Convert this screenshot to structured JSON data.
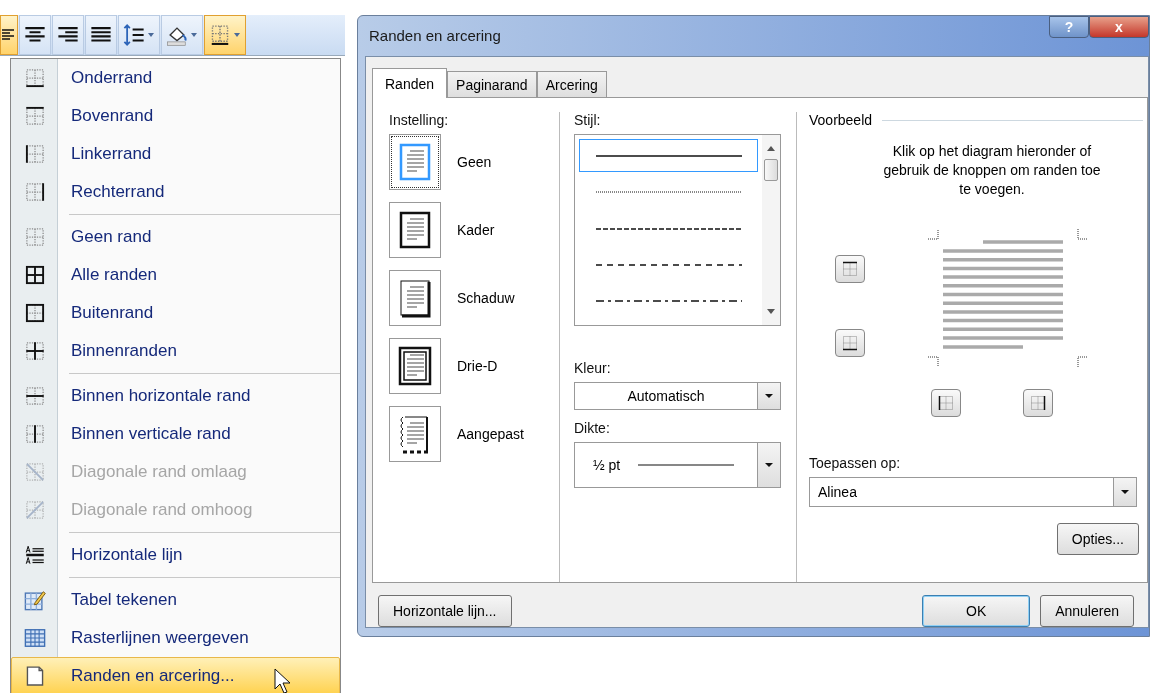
{
  "toolbar": [
    {
      "kind": "align-left",
      "selected": true
    },
    {
      "kind": "align-center",
      "selected": false
    },
    {
      "kind": "align-right",
      "selected": false
    },
    {
      "kind": "justify",
      "selected": false
    },
    {
      "kind": "line-spacing",
      "selected": false
    },
    {
      "kind": "shading",
      "selected": false
    },
    {
      "kind": "borders",
      "selected": true
    }
  ],
  "menu": {
    "items": [
      {
        "label": "Onderrand",
        "kind": "bottom",
        "disabled": false,
        "selected": false,
        "separator_after": false
      },
      {
        "label": "Bovenrand",
        "kind": "top",
        "disabled": false,
        "selected": false,
        "separator_after": false
      },
      {
        "label": "Linkerrand",
        "kind": "left",
        "disabled": false,
        "selected": false,
        "separator_after": false
      },
      {
        "label": "Rechterrand",
        "kind": "right",
        "disabled": false,
        "selected": false,
        "separator_after": true
      },
      {
        "label": "Geen rand",
        "kind": "none",
        "disabled": false,
        "selected": false,
        "separator_after": false
      },
      {
        "label": "Alle randen",
        "kind": "all",
        "disabled": false,
        "selected": false,
        "separator_after": false
      },
      {
        "label": "Buitenrand",
        "kind": "outside",
        "disabled": false,
        "selected": false,
        "separator_after": false
      },
      {
        "label": "Binnenranden",
        "kind": "inside",
        "disabled": false,
        "selected": false,
        "separator_after": true
      },
      {
        "label": "Binnen horizontale rand",
        "kind": "inside-h",
        "disabled": false,
        "selected": false,
        "separator_after": false
      },
      {
        "label": "Binnen verticale rand",
        "kind": "inside-v",
        "disabled": false,
        "selected": false,
        "separator_after": false
      },
      {
        "label": "Diagonale rand omlaag",
        "kind": "diag-down",
        "disabled": true,
        "selected": false,
        "separator_after": false
      },
      {
        "label": "Diagonale rand omhoog",
        "kind": "diag-up",
        "disabled": true,
        "selected": false,
        "separator_after": true
      },
      {
        "label": "Horizontale lijn",
        "kind": "hline",
        "disabled": false,
        "selected": false,
        "separator_after": true
      },
      {
        "label": "Tabel tekenen",
        "kind": "draw-table",
        "disabled": false,
        "selected": false,
        "separator_after": false
      },
      {
        "label": "Rasterlijnen weergeven",
        "kind": "gridlines",
        "disabled": false,
        "selected": false,
        "separator_after": false
      },
      {
        "label": "Randen en arcering...",
        "kind": "page",
        "disabled": false,
        "selected": true,
        "separator_after": false
      }
    ]
  },
  "dialog": {
    "title": "Randen en arcering",
    "help_button": "?",
    "close_button": "x",
    "tabs": [
      {
        "label": "Randen",
        "selected": true
      },
      {
        "label": "Paginarand",
        "selected": false
      },
      {
        "label": "Arcering",
        "selected": false
      }
    ],
    "setting": {
      "label": "Instelling:",
      "options": [
        {
          "label": "Geen",
          "kind": "none",
          "selected": true
        },
        {
          "label": "Kader",
          "kind": "box",
          "selected": false
        },
        {
          "label": "Schaduw",
          "kind": "shadow",
          "selected": false
        },
        {
          "label": "Drie-D",
          "kind": "triple",
          "selected": false
        },
        {
          "label": "Aangepast",
          "kind": "custom",
          "selected": false
        }
      ]
    },
    "style": {
      "label": "Stijl:",
      "lines": [
        {
          "kind": "solid",
          "selected": true
        },
        {
          "kind": "dotted",
          "selected": false
        },
        {
          "kind": "dashed",
          "selected": false
        },
        {
          "kind": "dash-wide",
          "selected": false
        },
        {
          "kind": "dash-dot",
          "selected": false
        }
      ]
    },
    "color": {
      "label": "Kleur:",
      "value": "Automatisch"
    },
    "width": {
      "label": "Dikte:",
      "value": "½ pt"
    },
    "preview": {
      "label": "Voorbeeld",
      "hint": "Klik op het diagram hieronder of gebruik de knoppen om randen toe te voegen.",
      "side_buttons": [
        {
          "kind": "top"
        },
        {
          "kind": "bottom"
        }
      ],
      "bottom_buttons": [
        {
          "kind": "left"
        },
        {
          "kind": "right"
        }
      ]
    },
    "apply_to": {
      "label": "Toepassen op:",
      "value": "Alinea"
    },
    "options_button": "Opties...",
    "horizontal_line_button": "Horizontale lijn...",
    "ok_button": "OK",
    "cancel_button": "Annuleren"
  }
}
